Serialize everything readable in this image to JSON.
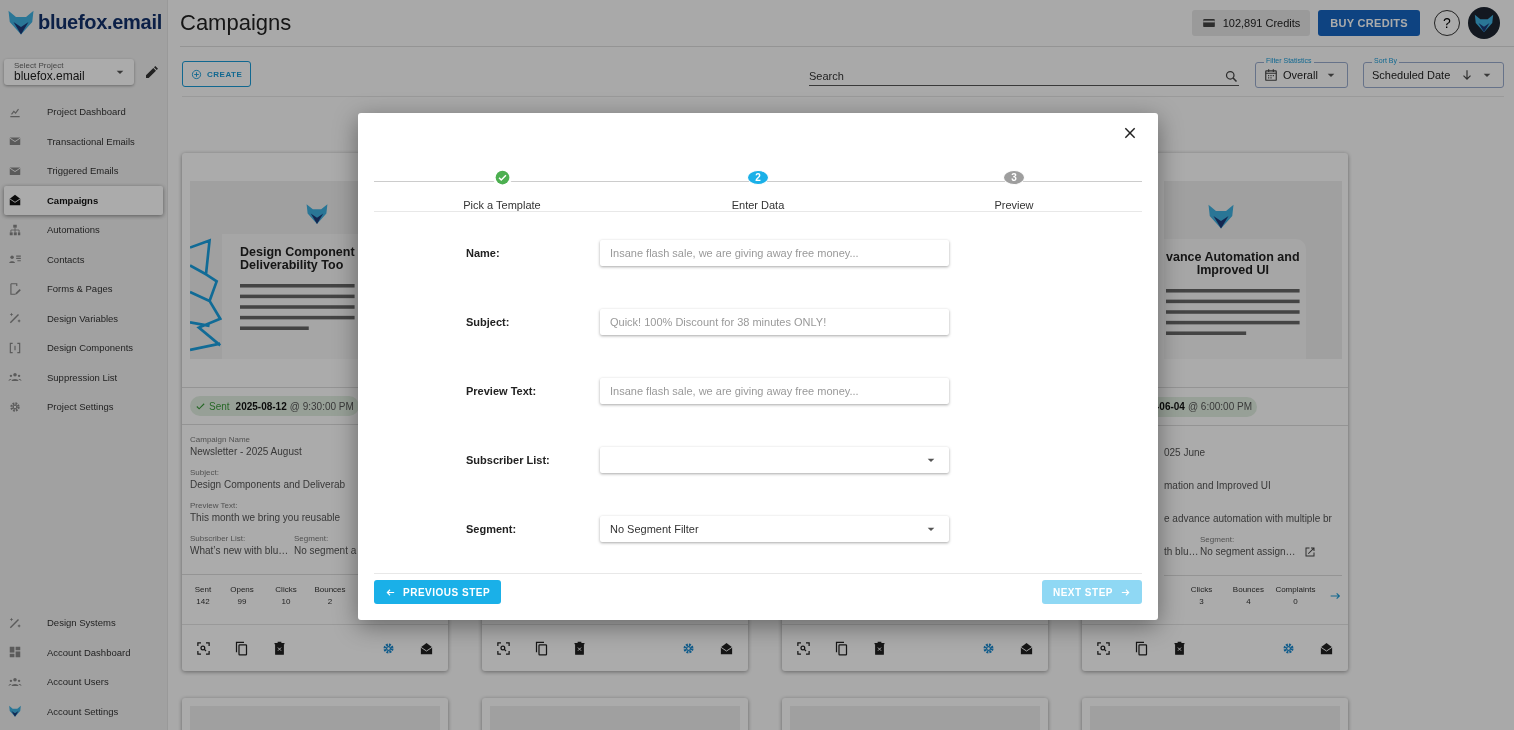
{
  "sidebar": {
    "logo": "bluefox.email",
    "project_select": {
      "label": "Select Project",
      "value": "bluefox.email"
    },
    "items": [
      {
        "label": "Project Dashboard",
        "selected": false
      },
      {
        "label": "Transactional Emails",
        "selected": false
      },
      {
        "label": "Triggered Emails",
        "selected": false
      },
      {
        "label": "Campaigns",
        "selected": true
      },
      {
        "label": "Automations",
        "selected": false
      },
      {
        "label": "Contacts",
        "selected": false
      },
      {
        "label": "Forms & Pages",
        "selected": false
      },
      {
        "label": "Design Variables",
        "selected": false
      },
      {
        "label": "Design Components",
        "selected": false
      },
      {
        "label": "Suppression List",
        "selected": false
      },
      {
        "label": "Project Settings",
        "selected": false
      }
    ],
    "bottom_items": [
      {
        "label": "Design Systems",
        "selected": false
      },
      {
        "label": "Account Dashboard",
        "selected": false
      },
      {
        "label": "Account Users",
        "selected": false
      },
      {
        "label": "Account Settings",
        "selected": false
      }
    ]
  },
  "header": {
    "title": "Campaigns",
    "credits": "102,891 Credits",
    "buy_button": "BUY CREDITS",
    "help": "?"
  },
  "toolbar": {
    "create": "CREATE",
    "search": {
      "placeholder": "Search"
    },
    "filter": {
      "label": "Filter Statistics",
      "value": "Overall"
    },
    "sort": {
      "label": "Sort By",
      "value": "Scheduled Date"
    }
  },
  "cards": [
    {
      "kind": "left",
      "heading": [
        "Design Component",
        "Deliverability Too"
      ],
      "status": {
        "kind": "sent",
        "label": "Sent",
        "date": "2025-08-12",
        "time": "@ 9:30:00 PM"
      },
      "fields": [
        {
          "label": "Campaign Name",
          "value": "Newsletter - 2025 August"
        },
        {
          "label": "Subject:",
          "value": "Design Components and Deliverab"
        },
        {
          "label": "Preview Text:",
          "value": "This month we bring you reusable"
        }
      ],
      "list": {
        "label": "Subscriber List:",
        "value": "What’s new with blu…"
      },
      "segment": {
        "label": "Segment:",
        "value": "No segment a"
      },
      "stats": [
        {
          "label": "Sent",
          "value": "142"
        },
        {
          "label": "Opens",
          "value": "99"
        },
        {
          "label": "Clicks",
          "value": "10"
        },
        {
          "label": "Bounces",
          "value": "2"
        }
      ]
    },
    {
      "kind": "covered"
    },
    {
      "kind": "covered"
    },
    {
      "kind": "right",
      "heading": [
        "vance Automation and",
        "Improved UI"
      ],
      "status": {
        "kind": "sent",
        "date": "-06-04",
        "time": "@ 6:00:00 PM"
      },
      "fields": [
        {
          "value": "025 June"
        },
        {
          "value": "mation and Improved UI"
        },
        {
          "value": "e advance automation with multiple br"
        }
      ],
      "list": {
        "value": "th blu…"
      },
      "segment": {
        "label": "Segment:",
        "value": "No segment assign…"
      },
      "stats": [
        {
          "label": "Clicks",
          "value": "3"
        },
        {
          "label": "Bounces",
          "value": "4"
        },
        {
          "label": "Complaints",
          "value": "0"
        }
      ]
    }
  ],
  "more_cards": [
    {
      "kind": "blank"
    },
    {
      "kind": "blank"
    },
    {
      "kind": "blank"
    },
    {
      "kind": "blank"
    }
  ],
  "modal": {
    "steps": [
      {
        "label": "Pick a Template",
        "completed": true,
        "selected": false
      },
      {
        "label": "Enter Data",
        "number": "2",
        "completed": false,
        "selected": true
      },
      {
        "label": "Preview",
        "number": "3",
        "completed": false,
        "selected": false
      }
    ],
    "fields": [
      {
        "label": "Name:",
        "kind": "text",
        "placeholder": "Insane flash sale, we are giving away free money..."
      },
      {
        "label": "Subject:",
        "kind": "text",
        "placeholder": "Quick! 100% Discount for 38 minutes ONLY!"
      },
      {
        "label": "Preview Text:",
        "kind": "text",
        "placeholder": "Insane flash sale, we are giving away free money..."
      },
      {
        "label": "Subscriber List:",
        "kind": "select"
      },
      {
        "label": "Segment:",
        "kind": "select",
        "value": "No Segment Filter"
      }
    ],
    "previous": {
      "label": "PREVIOUS STEP",
      "disabled": false
    },
    "next": {
      "label": "NEXT STEP",
      "disabled": true
    }
  }
}
